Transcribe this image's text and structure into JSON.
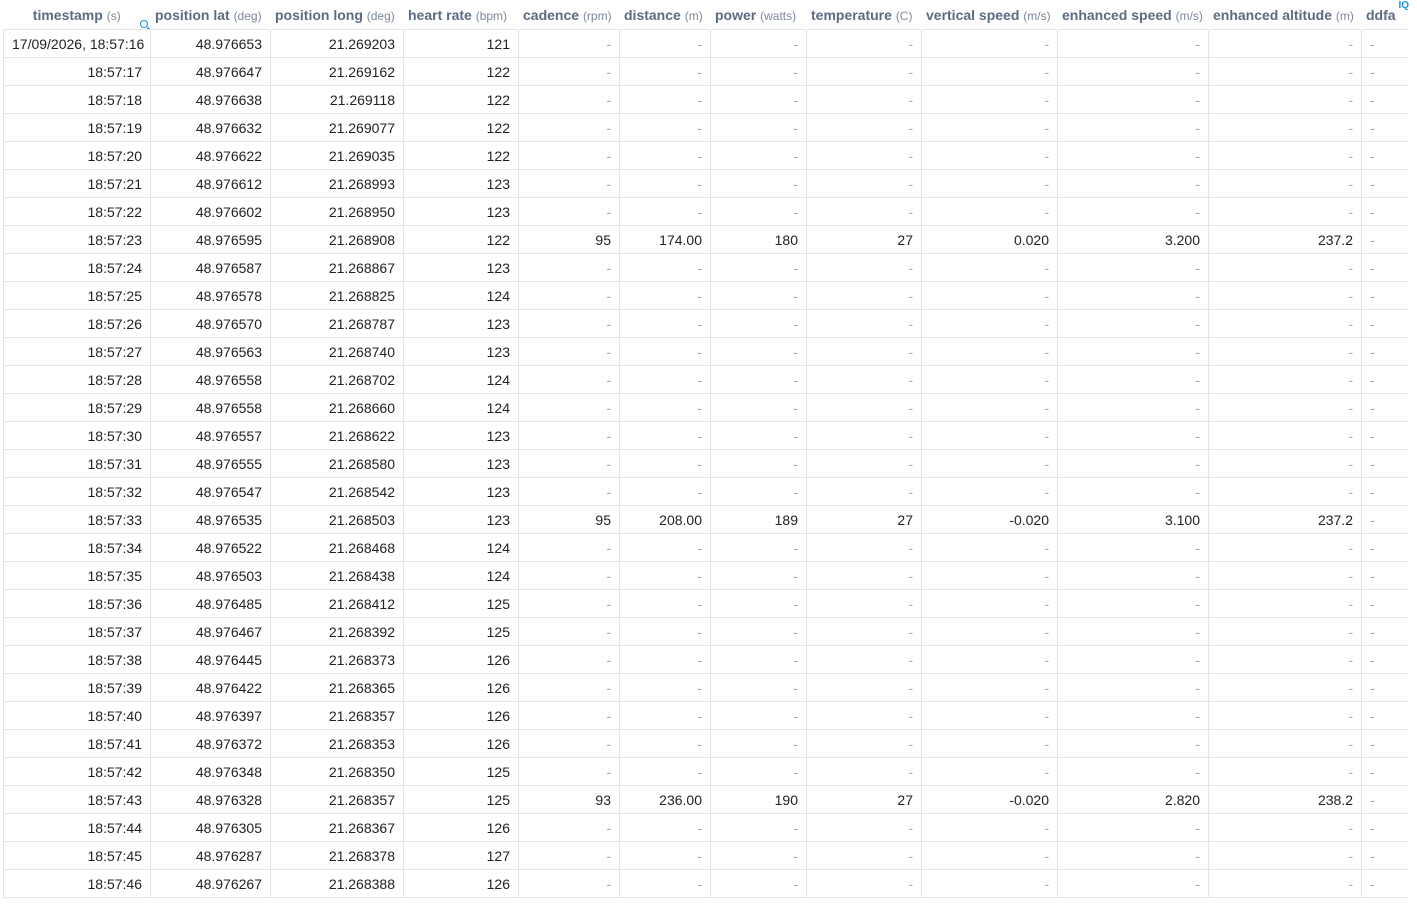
{
  "columns": [
    {
      "name": "timestamp",
      "unit": "(s)"
    },
    {
      "name": "position lat",
      "unit": "(deg)"
    },
    {
      "name": "position long",
      "unit": "(deg)"
    },
    {
      "name": "heart rate",
      "unit": "(bpm)"
    },
    {
      "name": "cadence",
      "unit": "(rpm)"
    },
    {
      "name": "distance",
      "unit": "(m)"
    },
    {
      "name": "power",
      "unit": "(watts)"
    },
    {
      "name": "temperature",
      "unit": "(C)"
    },
    {
      "name": "vertical speed",
      "unit": "(m/s)"
    },
    {
      "name": "enhanced speed",
      "unit": "(m/s)"
    },
    {
      "name": "enhanced altitude",
      "unit": "(m)"
    },
    {
      "name": "ddfa",
      "unit": ""
    }
  ],
  "icons": {
    "search": "search-icon",
    "iq": "IQ",
    "accent": "#1a8fd8"
  },
  "rows": [
    [
      "17/09/2026, 18:57:16",
      "48.976653",
      "21.269203",
      "121",
      "-",
      "-",
      "-",
      "-",
      "-",
      "-",
      "-",
      "-"
    ],
    [
      "18:57:17",
      "48.976647",
      "21.269162",
      "122",
      "-",
      "-",
      "-",
      "-",
      "-",
      "-",
      "-",
      "-"
    ],
    [
      "18:57:18",
      "48.976638",
      "21.269118",
      "122",
      "-",
      "-",
      "-",
      "-",
      "-",
      "-",
      "-",
      "-"
    ],
    [
      "18:57:19",
      "48.976632",
      "21.269077",
      "122",
      "-",
      "-",
      "-",
      "-",
      "-",
      "-",
      "-",
      "-"
    ],
    [
      "18:57:20",
      "48.976622",
      "21.269035",
      "122",
      "-",
      "-",
      "-",
      "-",
      "-",
      "-",
      "-",
      "-"
    ],
    [
      "18:57:21",
      "48.976612",
      "21.268993",
      "123",
      "-",
      "-",
      "-",
      "-",
      "-",
      "-",
      "-",
      "-"
    ],
    [
      "18:57:22",
      "48.976602",
      "21.268950",
      "123",
      "-",
      "-",
      "-",
      "-",
      "-",
      "-",
      "-",
      "-"
    ],
    [
      "18:57:23",
      "48.976595",
      "21.268908",
      "122",
      "95",
      "174.00",
      "180",
      "27",
      "0.020",
      "3.200",
      "237.2",
      "-"
    ],
    [
      "18:57:24",
      "48.976587",
      "21.268867",
      "123",
      "-",
      "-",
      "-",
      "-",
      "-",
      "-",
      "-",
      "-"
    ],
    [
      "18:57:25",
      "48.976578",
      "21.268825",
      "124",
      "-",
      "-",
      "-",
      "-",
      "-",
      "-",
      "-",
      "-"
    ],
    [
      "18:57:26",
      "48.976570",
      "21.268787",
      "123",
      "-",
      "-",
      "-",
      "-",
      "-",
      "-",
      "-",
      "-"
    ],
    [
      "18:57:27",
      "48.976563",
      "21.268740",
      "123",
      "-",
      "-",
      "-",
      "-",
      "-",
      "-",
      "-",
      "-"
    ],
    [
      "18:57:28",
      "48.976558",
      "21.268702",
      "124",
      "-",
      "-",
      "-",
      "-",
      "-",
      "-",
      "-",
      "-"
    ],
    [
      "18:57:29",
      "48.976558",
      "21.268660",
      "124",
      "-",
      "-",
      "-",
      "-",
      "-",
      "-",
      "-",
      "-"
    ],
    [
      "18:57:30",
      "48.976557",
      "21.268622",
      "123",
      "-",
      "-",
      "-",
      "-",
      "-",
      "-",
      "-",
      "-"
    ],
    [
      "18:57:31",
      "48.976555",
      "21.268580",
      "123",
      "-",
      "-",
      "-",
      "-",
      "-",
      "-",
      "-",
      "-"
    ],
    [
      "18:57:32",
      "48.976547",
      "21.268542",
      "123",
      "-",
      "-",
      "-",
      "-",
      "-",
      "-",
      "-",
      "-"
    ],
    [
      "18:57:33",
      "48.976535",
      "21.268503",
      "123",
      "95",
      "208.00",
      "189",
      "27",
      "-0.020",
      "3.100",
      "237.2",
      "-"
    ],
    [
      "18:57:34",
      "48.976522",
      "21.268468",
      "124",
      "-",
      "-",
      "-",
      "-",
      "-",
      "-",
      "-",
      "-"
    ],
    [
      "18:57:35",
      "48.976503",
      "21.268438",
      "124",
      "-",
      "-",
      "-",
      "-",
      "-",
      "-",
      "-",
      "-"
    ],
    [
      "18:57:36",
      "48.976485",
      "21.268412",
      "125",
      "-",
      "-",
      "-",
      "-",
      "-",
      "-",
      "-",
      "-"
    ],
    [
      "18:57:37",
      "48.976467",
      "21.268392",
      "125",
      "-",
      "-",
      "-",
      "-",
      "-",
      "-",
      "-",
      "-"
    ],
    [
      "18:57:38",
      "48.976445",
      "21.268373",
      "126",
      "-",
      "-",
      "-",
      "-",
      "-",
      "-",
      "-",
      "-"
    ],
    [
      "18:57:39",
      "48.976422",
      "21.268365",
      "126",
      "-",
      "-",
      "-",
      "-",
      "-",
      "-",
      "-",
      "-"
    ],
    [
      "18:57:40",
      "48.976397",
      "21.268357",
      "126",
      "-",
      "-",
      "-",
      "-",
      "-",
      "-",
      "-",
      "-"
    ],
    [
      "18:57:41",
      "48.976372",
      "21.268353",
      "126",
      "-",
      "-",
      "-",
      "-",
      "-",
      "-",
      "-",
      "-"
    ],
    [
      "18:57:42",
      "48.976348",
      "21.268350",
      "125",
      "-",
      "-",
      "-",
      "-",
      "-",
      "-",
      "-",
      "-"
    ],
    [
      "18:57:43",
      "48.976328",
      "21.268357",
      "125",
      "93",
      "236.00",
      "190",
      "27",
      "-0.020",
      "2.820",
      "238.2",
      "-"
    ],
    [
      "18:57:44",
      "48.976305",
      "21.268367",
      "126",
      "-",
      "-",
      "-",
      "-",
      "-",
      "-",
      "-",
      "-"
    ],
    [
      "18:57:45",
      "48.976287",
      "21.268378",
      "127",
      "-",
      "-",
      "-",
      "-",
      "-",
      "-",
      "-",
      "-"
    ],
    [
      "18:57:46",
      "48.976267",
      "21.268388",
      "126",
      "-",
      "-",
      "-",
      "-",
      "-",
      "-",
      "-",
      "-"
    ]
  ]
}
